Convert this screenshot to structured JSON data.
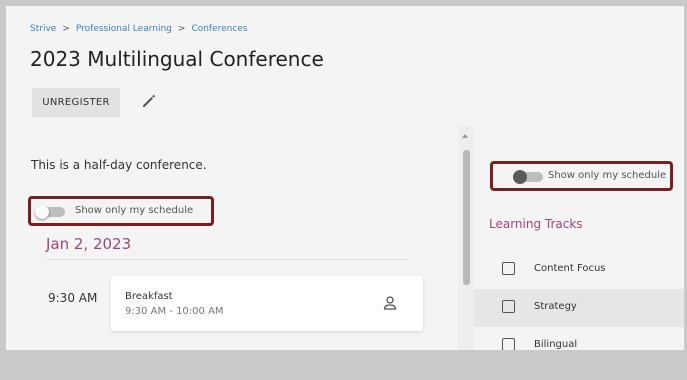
{
  "breadcrumb": {
    "items": [
      "Strive",
      "Professional Learning",
      "Conferences"
    ],
    "separator": ">"
  },
  "page": {
    "title": "2023 Multilingual Conference",
    "unregister_label": "UNREGISTER",
    "description": "This is a half-day conference."
  },
  "schedule_toggle": {
    "label": "Show only my schedule",
    "checked": false
  },
  "agenda": {
    "date": "Jan 2, 2023",
    "sessions": [
      {
        "time": "9:30 AM",
        "title": "Breakfast",
        "time_range": "9:30 AM - 10:00 AM"
      }
    ]
  },
  "learning_tracks": {
    "title": "Learning Tracks",
    "items": [
      {
        "label": "Content Focus",
        "checked": false
      },
      {
        "label": "Strategy",
        "checked": false
      },
      {
        "label": "Bilingual",
        "checked": false
      }
    ]
  },
  "icons": {
    "edit": "pencil-icon",
    "attendee": "person-icon"
  },
  "colors": {
    "accent": "#a0457a",
    "link": "#3a7fc4",
    "highlight_border": "#7a1f1f"
  }
}
